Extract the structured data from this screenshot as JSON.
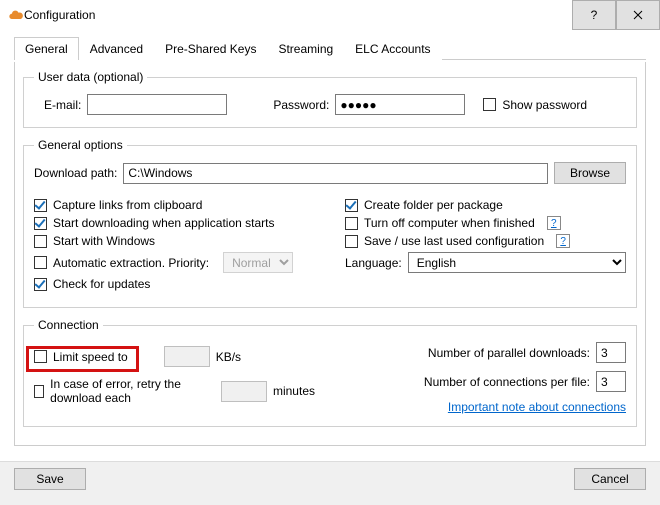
{
  "window": {
    "title": "Configuration"
  },
  "tabs": [
    "General",
    "Advanced",
    "Pre-Shared Keys",
    "Streaming",
    "ELC Accounts"
  ],
  "userdata": {
    "legend": "User data (optional)",
    "email_label": "E-mail:",
    "email_value": "",
    "password_label": "Password:",
    "password_value": "●●●●●",
    "show_password_label": "Show password"
  },
  "general_options": {
    "legend": "General options",
    "download_path_label": "Download path:",
    "download_path_value": "C:\\Windows",
    "browse_label": "Browse",
    "left": {
      "capture_links": {
        "label": "Capture links from clipboard",
        "checked": true
      },
      "start_download": {
        "label": "Start downloading when application starts",
        "checked": true
      },
      "start_windows": {
        "label": "Start with Windows",
        "checked": false
      },
      "auto_extract": {
        "label": "Automatic extraction. Priority:",
        "checked": false,
        "priority": "Normal"
      },
      "check_updates": {
        "label": "Check for updates",
        "checked": true
      }
    },
    "right": {
      "create_folder": {
        "label": "Create folder per package",
        "checked": true
      },
      "turn_off": {
        "label": "Turn off computer when finished",
        "checked": false
      },
      "save_config": {
        "label": "Save / use last used configuration",
        "checked": false
      },
      "language_label": "Language:",
      "language_value": "English"
    }
  },
  "connection": {
    "legend": "Connection",
    "limit_speed": {
      "label": "Limit speed to",
      "checked": false,
      "value": "",
      "unit": "KB/s"
    },
    "retry": {
      "label": "In case of error, retry the download each",
      "checked": false,
      "value": "",
      "unit": "minutes"
    },
    "parallel_label": "Number of parallel downloads:",
    "parallel_value": "3",
    "perfile_label": "Number of connections per file:",
    "perfile_value": "3",
    "note_link": "Important note about connections"
  },
  "footer": {
    "save": "Save",
    "cancel": "Cancel"
  }
}
